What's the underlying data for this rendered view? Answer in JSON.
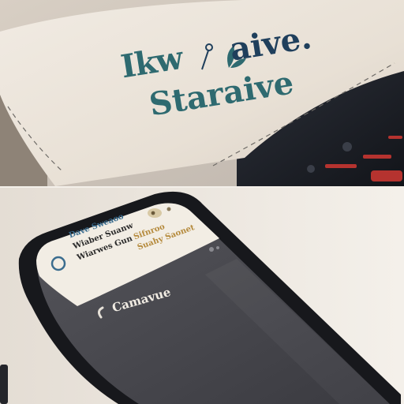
{
  "top_panel": {
    "logo_line1": "Ikw",
    "logo_line1_tail": "aive.",
    "logo_line2": "Staraive",
    "colors": {
      "teal": "#2e6a70",
      "navy": "#1f3f5c",
      "paper": "#e9e1d6",
      "device_dark": "#1c1f26",
      "accent_red": "#b5332f"
    }
  },
  "bottom_panel": {
    "card_header": "Dave Sweaoo",
    "card_line1": "Wiaber Suanw",
    "card_line2": "Wiarwes Gun",
    "gold_line1": "Sifnroo",
    "gold_line2": "Suahy Saonet",
    "title": "Camavue",
    "colors": {
      "phone_body": "#17181c",
      "screen_dark": "#4a4a50",
      "card_bg": "#f2ede4",
      "blue_text": "#3b6d8f",
      "gold_text": "#b58a3c"
    }
  }
}
